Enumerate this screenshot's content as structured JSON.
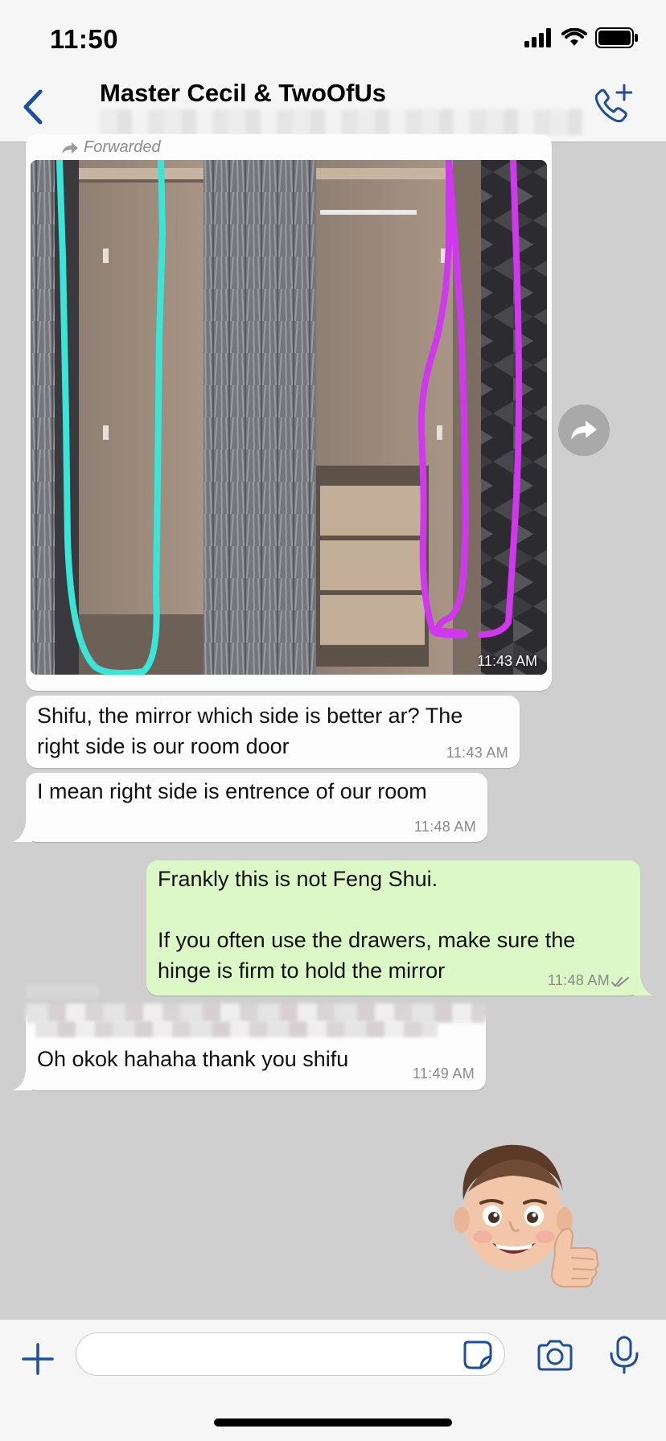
{
  "status_bar": {
    "time": "11:50"
  },
  "header": {
    "title": "Master Cecil & TwoOfUs"
  },
  "messages": {
    "photo": {
      "forwarded_label": "Forwarded",
      "time": "11:43 AM"
    },
    "m1": {
      "text": "Shifu, the mirror which side is better ar? The\nright side is our room door",
      "time": "11:43 AM"
    },
    "m2": {
      "text": "I mean right side is entrence of our room",
      "time": "11:48 AM"
    },
    "m3": {
      "text": "Frankly this is not Feng Shui.\n\nIf you often use the drawers, make sure the\nhinge is firm to hold the mirror",
      "time": "11:48 AM",
      "status": "read"
    },
    "m4": {
      "text": "Oh okok hahaha thank you shifu",
      "time": "11:49 AM"
    }
  },
  "colors": {
    "incoming_bubble": "#fdfdfd",
    "outgoing_bubble": "#dcf8c6",
    "accent": "#1d4f9a",
    "chat_background": "#cfcfcf",
    "read_ticks": "#8a8a8a"
  },
  "icons": {
    "back": "chevron-left-icon",
    "call": "phone-plus-icon",
    "share": "share-arrow-icon",
    "plus": "plus-icon",
    "sticker": "sticker-icon",
    "camera": "camera-icon",
    "mic": "microphone-icon"
  }
}
